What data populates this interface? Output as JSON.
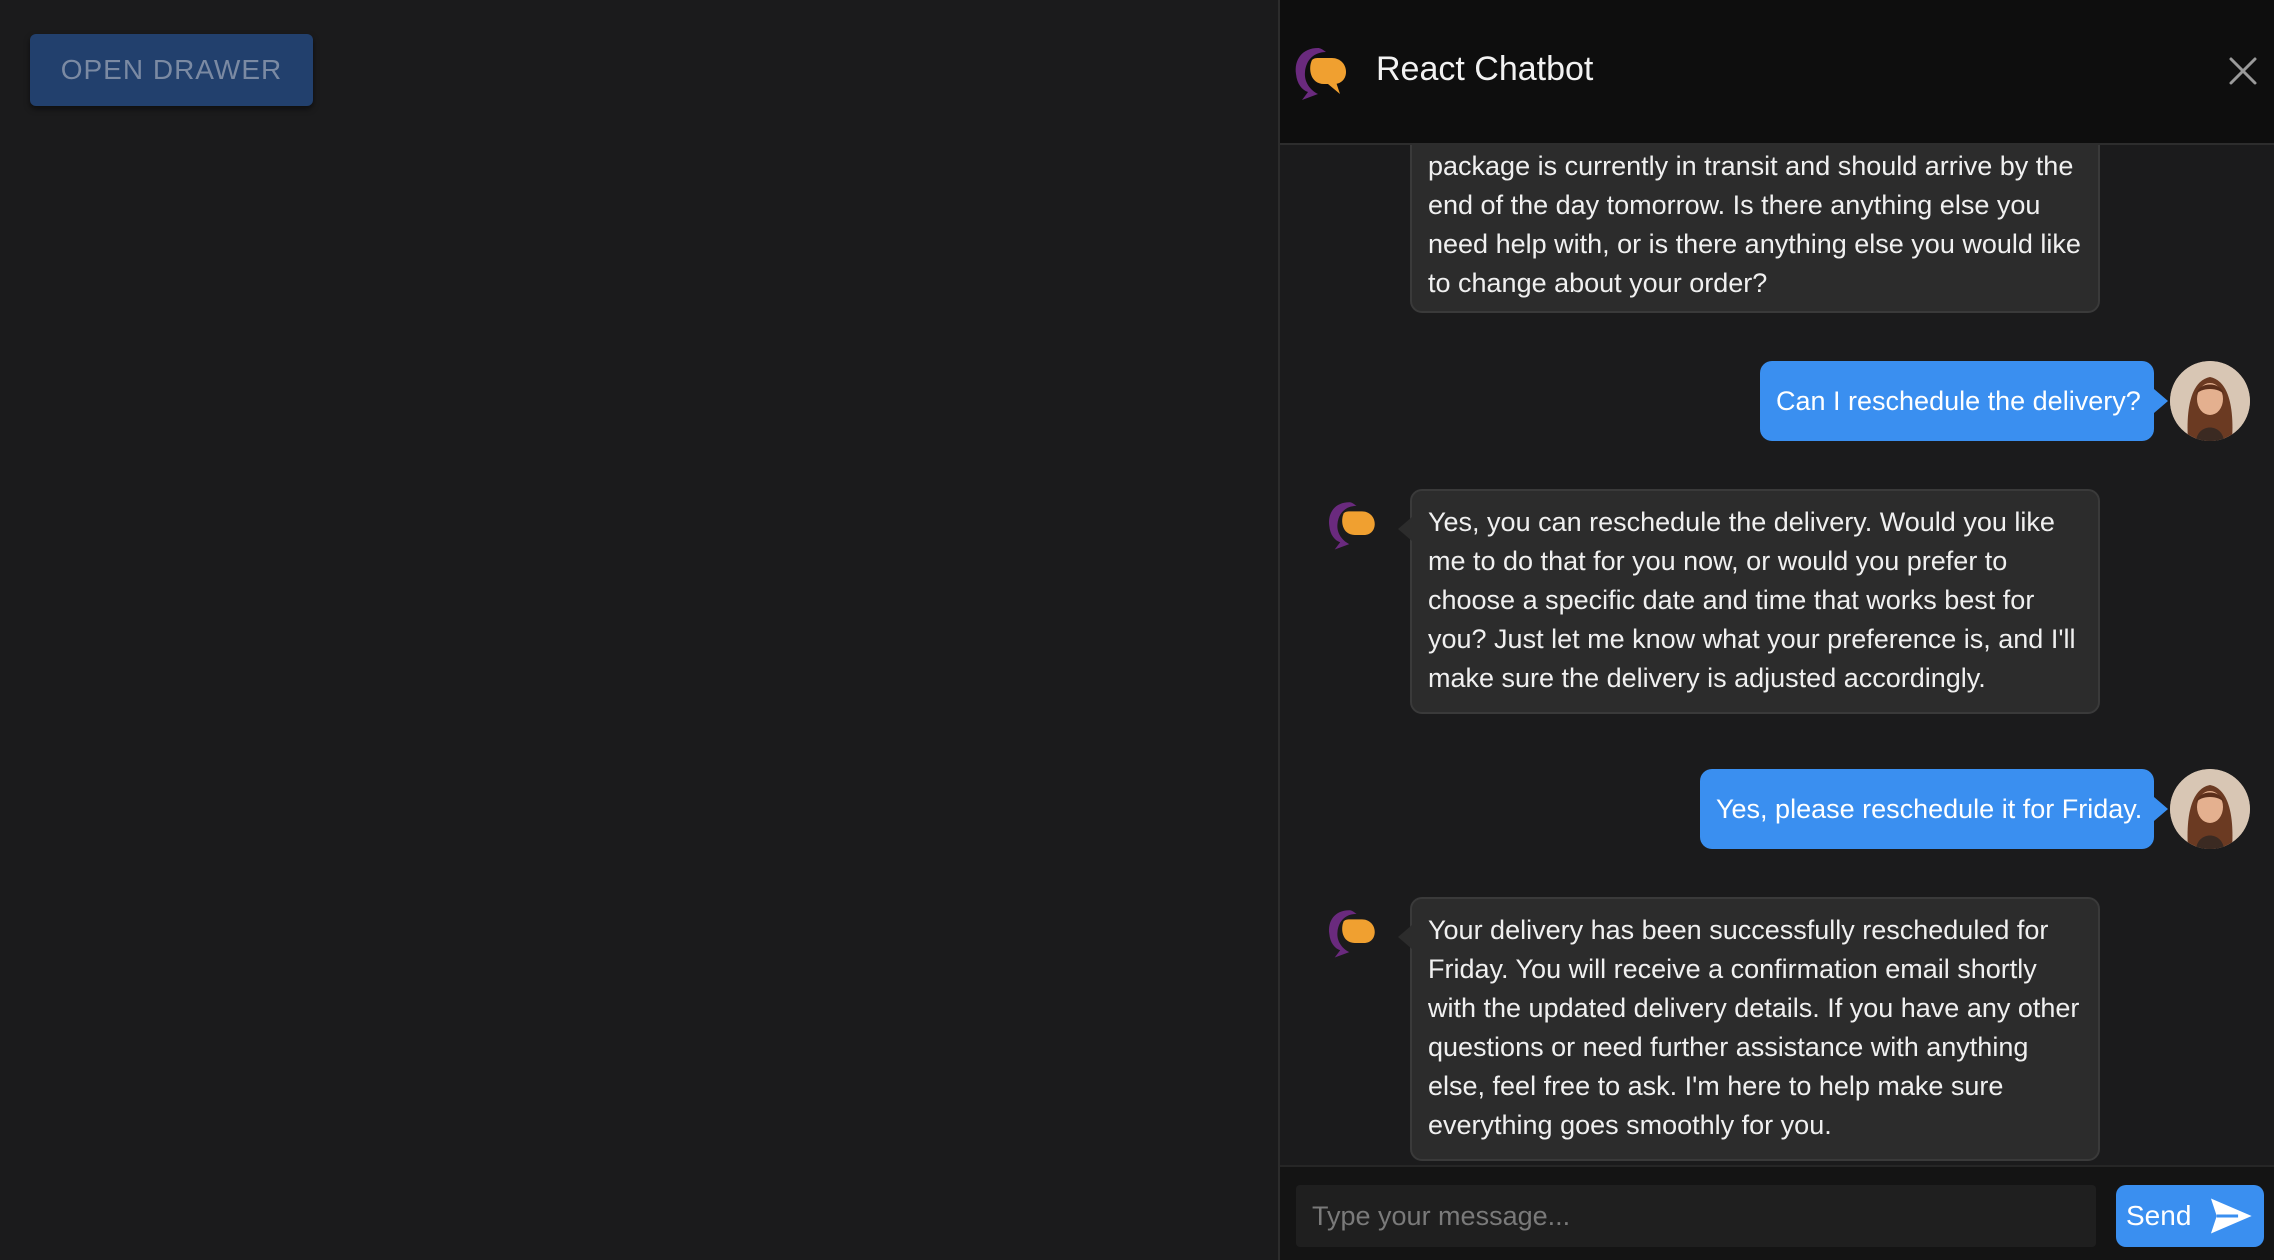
{
  "left": {
    "open_drawer_label": "OPEN DRAWER"
  },
  "chatbot": {
    "title": "React Chatbot",
    "close_icon": "close-icon",
    "messages": [
      {
        "sender": "bot",
        "text": "package is currently in transit and should arrive by the end of the day tomorrow. Is there anything else you need help with, or is there anything else you would like to change about your order?"
      },
      {
        "sender": "user",
        "text": "Can I reschedule the delivery?"
      },
      {
        "sender": "bot",
        "text": "Yes, you can reschedule the delivery. Would you like me to do that for you now, or would you prefer to choose a specific date and time that works best for you? Just let me know what your preference is, and I'll make sure the delivery is adjusted accordingly."
      },
      {
        "sender": "user",
        "text": "Yes, please reschedule it for Friday."
      },
      {
        "sender": "bot",
        "text": "Your delivery has been successfully rescheduled for Friday. You will receive a confirmation email shortly with the updated delivery details. If you have any other questions or need further assistance with anything else, feel free to ask. I'm here to help make sure everything goes smoothly for you."
      }
    ],
    "input": {
      "placeholder": "Type your message...",
      "value": ""
    },
    "send_label": "Send",
    "send_icon": "send-arrow-icon"
  },
  "colors": {
    "accent_blue": "#3a8ff0",
    "logo_purple": "#6a2a7e",
    "logo_orange": "#f0a030",
    "button_dark_blue": "#22406d"
  }
}
